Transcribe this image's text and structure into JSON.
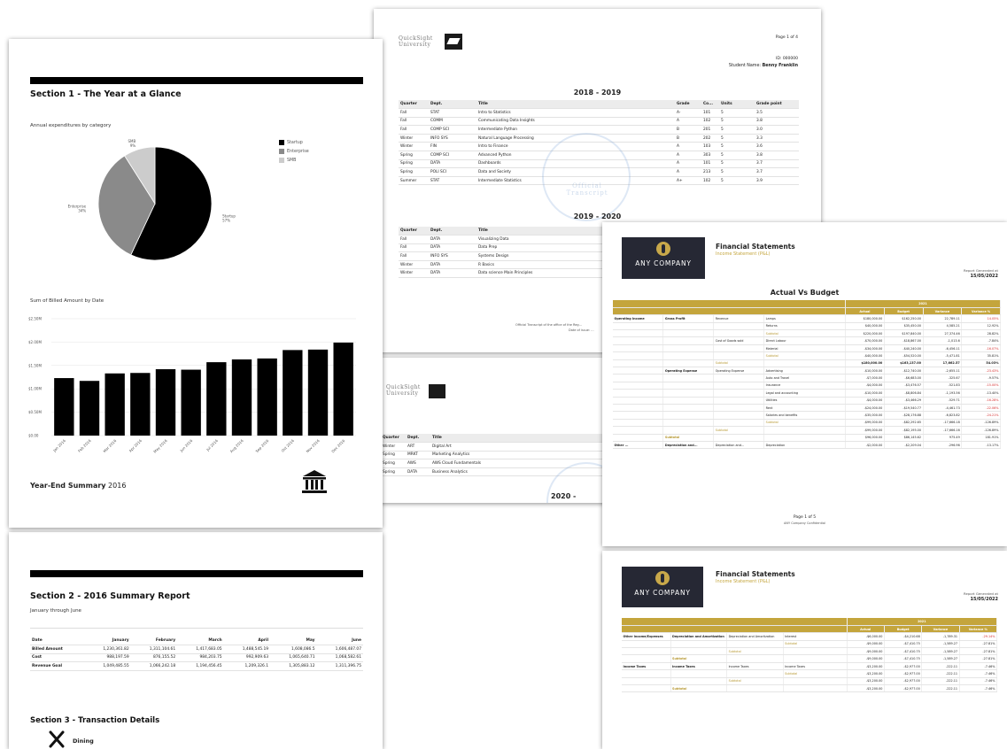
{
  "page1": {
    "section_title": "Section 1 - The Year at a Glance",
    "pie_title": "Annual expenditures by category",
    "legend": [
      "Startup",
      "Enterprise",
      "SMB"
    ],
    "pie_labels": {
      "startup": "Startup\n57%",
      "enterprise": "Enterprise\n34%",
      "smb": "SMB\n9%"
    },
    "bar_title": "Sum of Billed Amount by Date",
    "yticks": [
      "$2.50M",
      "$2.00M",
      "$1.50M",
      "$1.00M",
      "$0.50M",
      "$0.00"
    ],
    "xticks": [
      "Jan 2016",
      "Feb 2016",
      "Mar 2016",
      "Apr 2016",
      "May 2016",
      "Jun 2016",
      "Jul 2016",
      "Aug 2016",
      "Sep 2016",
      "Oct 2016",
      "Nov 2016",
      "Dec 2016"
    ],
    "summary_bold": "Year-End Summary",
    "summary_year": " 2016"
  },
  "page2": {
    "section2_title": "Section 2 - 2016 Summary Report",
    "subtitle": "January through June",
    "headers": [
      "Date",
      "January",
      "February",
      "March",
      "April",
      "May",
      "June"
    ],
    "rows": [
      [
        "Billed Amount",
        "1,230,361.82",
        "1,311,104.61",
        "1,417,683.05",
        "1,488,545.19",
        "1,608,086.5",
        "1,606,487.07"
      ],
      [
        "Cost",
        "988,197.59",
        "876,155.52",
        "984,203.75",
        "992,909.63",
        "1,065,640.71",
        "1,068,582.61"
      ],
      [
        "Revenue Goal",
        "1,049,485.55",
        "1,066,242.18",
        "1,194,456.45",
        "1,209,326.1",
        "1,305,883.12",
        "1,311,396.75"
      ]
    ],
    "section3_title": "Section 3 - Transaction Details",
    "dining_label": "Dining"
  },
  "transcript": {
    "school_name": "QuickSight University",
    "page_label": "Page 1 of 4",
    "id_label": "ID: 000000",
    "student_label": "Student Name:",
    "student_name": "Benny Franklin",
    "year1": "2018 - 2019",
    "headers": [
      "Quarter",
      "Dept.",
      "Title",
      "Grade",
      "Co...",
      "Units",
      "Grade point"
    ],
    "rows1": [
      [
        "Fall",
        "STAT",
        "Intro to Statistics",
        "A-",
        "101",
        "5",
        "3.5"
      ],
      [
        "Fall",
        "COMM",
        "Communicating Data Insights",
        "A",
        "102",
        "5",
        "3.8"
      ],
      [
        "Fall",
        "COMP SCI",
        "Intermediate Python",
        "B",
        "201",
        "5",
        "3.0"
      ],
      [
        "Winter",
        "INFO SYS",
        "Natural Language Processing",
        "B",
        "202",
        "5",
        "3.3"
      ],
      [
        "Winter",
        "FIN",
        "Intro to Finance",
        "A",
        "103",
        "5",
        "3.6"
      ],
      [
        "Spring",
        "COMP SCI",
        "Advanced Python",
        "A",
        "303",
        "5",
        "3.8"
      ],
      [
        "Spring",
        "DATA",
        "Dashboards",
        "A",
        "101",
        "5",
        "3.7"
      ],
      [
        "Spring",
        "POLI SCI",
        "Data and Society",
        "A",
        "213",
        "5",
        "3.7"
      ],
      [
        "Summer",
        "STAT",
        "Intermediate Statistics",
        "A+",
        "102",
        "5",
        "3.9"
      ]
    ],
    "year2": "2019 - 2020",
    "rows2": [
      [
        "Fall",
        "DATA",
        "Visualizing Data"
      ],
      [
        "Fall",
        "DATA",
        "Data Prep"
      ],
      [
        "Fall",
        "INFO SYS",
        "Systems Design"
      ],
      [
        "Winter",
        "DATA",
        "R Basics"
      ],
      [
        "Winter",
        "DATA",
        "Data science Main Principles"
      ]
    ],
    "footer1": "Official Transcript of the office of the Reg...",
    "footer2": "Date of issue: ...",
    "stamp": "Official Transcript",
    "rows3": [
      [
        "Winter",
        "ART",
        "Digital Art"
      ],
      [
        "Spring",
        "MRKT",
        "Marketing Analytics"
      ],
      [
        "Spring",
        "AWS",
        "AWS Cloud Fundamentals"
      ],
      [
        "Spring",
        "DATA",
        "Business Analytics"
      ]
    ],
    "year3": "2020 -"
  },
  "finance": {
    "company": "ANY COMPANY",
    "title": "Financial Statements",
    "subtitle": "Income Statement (P&L)",
    "report_label": "Report Generated at",
    "report_date": "15/05/2022",
    "table_title": "Actual Vs Budget",
    "year": "2021",
    "col_headers": [
      "Actual",
      "Budget",
      "Variance",
      "Variance %"
    ],
    "rows": [
      [
        "Operating Income",
        "Gross Profit",
        "Revenue",
        "Lamps",
        "$180,000.00",
        "$162,250.00",
        "22,789.11",
        "14.05%",
        "neg"
      ],
      [
        "",
        "",
        "",
        "Returns",
        "$40,000.00",
        "$35,450.00",
        "4,585.21",
        "12.92%",
        ""
      ],
      [
        "",
        "",
        "",
        "Subtotal",
        "$220,000.00",
        "$197,840.00",
        "27,374.46",
        "28.82%",
        "gold"
      ],
      [
        "",
        "",
        "Cost of Goods sold",
        "Direct Labour",
        "-$70,000.00",
        "-$18,867.00",
        "-1,013.6",
        "-7.84%",
        ""
      ],
      [
        "",
        "",
        "",
        "Material",
        "-$34,000.00",
        "-$40,240.00",
        "-6,456.11",
        "-16.07%",
        "neg"
      ],
      [
        "",
        "",
        "",
        "Subtotal",
        "-$40,000.00",
        "-$54,520.00",
        "-5,471.81",
        "35.81%",
        "gold"
      ],
      [
        "",
        "",
        "Subtotal",
        "",
        "$180,000.00",
        "$163,137.00",
        "17,662.57",
        "54.03%",
        "bold"
      ],
      [
        "",
        "Operating Expense",
        "Operating Expense",
        "Advertising",
        "-$10,000.00",
        "-$12,740.00",
        "-2,655.11",
        "-23.43%",
        "neg"
      ],
      [
        "",
        "",
        "",
        "Auto and Travel",
        "-$7,000.00",
        "-$6,683.00",
        "-325.67",
        "-9.57%",
        ""
      ],
      [
        "",
        "",
        "",
        "Insurance",
        "-$4,000.00",
        "-$3,476.57",
        "-521.83",
        "-15.00%",
        "neg"
      ],
      [
        "",
        "",
        "",
        "Legal and accounting",
        "-$10,000.00",
        "-$8,806.84",
        "-1,193.56",
        "-13.40%",
        ""
      ],
      [
        "",
        "",
        "",
        "Utilities",
        "-$4,000.00",
        "-$3,466.29",
        "-529.71",
        "-16.28%",
        "neg"
      ],
      [
        "",
        "",
        "",
        "Rent",
        "-$24,000.00",
        "-$19,540.77",
        "-4,461.73",
        "-22.06%",
        "neg"
      ],
      [
        "",
        "",
        "",
        "Salaries and benefits",
        "-$35,000.00",
        "-$28,176.88",
        "-6,823.82",
        "-24.21%",
        "neg"
      ],
      [
        "",
        "",
        "",
        "Subtotal",
        "-$99,000.00",
        "-$82,292.65",
        "-17,666.18",
        "-126.89%",
        "gold"
      ],
      [
        "",
        "",
        "Subtotal",
        "",
        "-$99,000.00",
        "-$82,195.00",
        "-17,666.16",
        "-126.89%",
        ""
      ],
      [
        "",
        "Subtotal",
        "",
        "",
        "$96,000.00",
        "$86,145.62",
        "975.49",
        "181.91%",
        "gold"
      ],
      [
        "Other ...",
        "Depreciation and...",
        "Depreciation and...",
        "Depreciation",
        "-$2,000.00",
        "-$2,209.04",
        "-296.96",
        "-13.17%",
        ""
      ]
    ],
    "page_footer": "Page 1 of 5",
    "page_footer2": "ANY Company Confidential",
    "rows_b": [
      [
        "Other Income/Expenses",
        "Depreciation and Amortization",
        "Depreciation and Amortization",
        "Interest",
        "-$6,000.00",
        "-$4,210.68",
        "-1,789.31",
        "-29.14%",
        "neg"
      ],
      [
        "",
        "",
        "",
        "Subtotal",
        "-$9,000.00",
        "-$7,410.75",
        "-1,589.27",
        "-27.81%",
        "gold"
      ],
      [
        "",
        "",
        "Subtotal",
        "",
        "-$9,000.00",
        "-$7,410.75",
        "-1,589.27",
        "-27.81%",
        ""
      ],
      [
        "",
        "Subtotal",
        "",
        "",
        "-$9,000.00",
        "-$7,410.75",
        "-1,589.27",
        "-27.81%",
        "gold"
      ],
      [
        "Income Taxes",
        "Income Taxes",
        "Income Taxes",
        "Income Taxes",
        "-$3,200.00",
        "-$2,977.00",
        "-222.11",
        "-7.46%",
        ""
      ],
      [
        "",
        "",
        "",
        "Subtotal",
        "-$3,200.00",
        "-$2,977.00",
        "-222.11",
        "-7.46%",
        "gold"
      ],
      [
        "",
        "",
        "Subtotal",
        "",
        "-$3,200.00",
        "-$2,977.00",
        "-222.11",
        "-7.46%",
        ""
      ],
      [
        "",
        "Subtotal",
        "",
        "",
        "-$3,200.00",
        "-$2,977.00",
        "-222.11",
        "-7.46%",
        "gold"
      ]
    ]
  },
  "chart_data": [
    {
      "type": "pie",
      "title": "Annual expenditures by category",
      "categories": [
        "Startup",
        "Enterprise",
        "SMB"
      ],
      "values": [
        57,
        34,
        9
      ],
      "colors": [
        "#000000",
        "#8a8a8a",
        "#cccccc"
      ],
      "legend": "right"
    },
    {
      "type": "bar",
      "title": "Sum of Billed Amount by Date",
      "categories": [
        "Jan 2016",
        "Feb 2016",
        "Mar 2016",
        "Apr 2016",
        "May 2016",
        "Jun 2016",
        "Jul 2016",
        "Aug 2016",
        "Sep 2016",
        "Oct 2016",
        "Nov 2016",
        "Dec 2016"
      ],
      "values": [
        1.23,
        1.17,
        1.33,
        1.34,
        1.42,
        1.41,
        1.57,
        1.63,
        1.65,
        1.83,
        1.84,
        1.99
      ],
      "ylim": [
        0,
        2.5
      ],
      "color": "#000000"
    }
  ]
}
